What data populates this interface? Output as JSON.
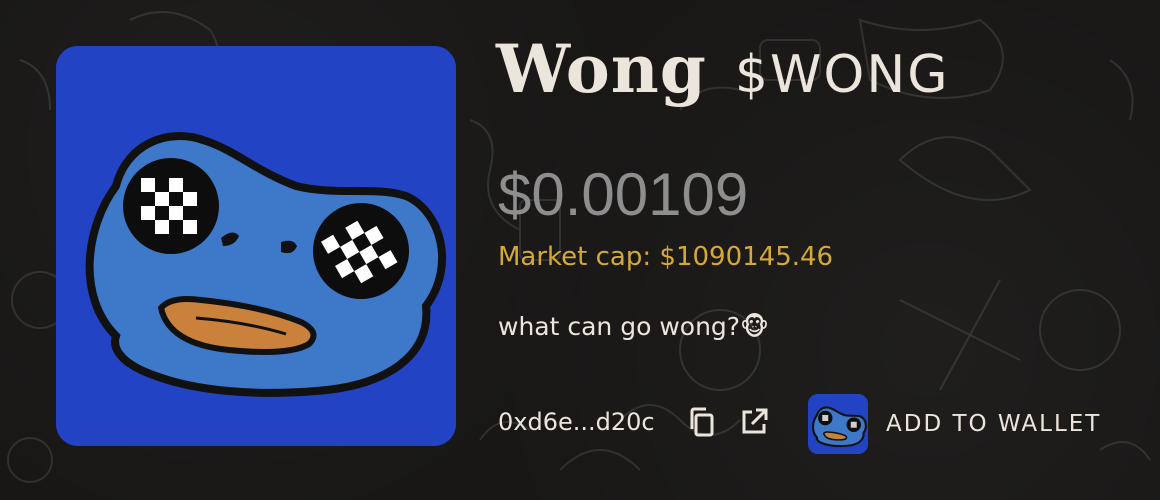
{
  "token": {
    "name": "Wong",
    "ticker": "$WONG",
    "price": "$0.00109",
    "market_cap": "Market cap: $1090145.46",
    "tagline": "what can go wong?🐵",
    "address": "0xd6e...d20c",
    "image_icon": "frog-face-icon"
  },
  "actions": {
    "copy_icon": "copy-icon",
    "external_icon": "external-link-icon",
    "add_to_wallet_label": "ADD TO WALLET"
  },
  "colors": {
    "background": "#181716",
    "token_blue": "#2243c3",
    "frog_blue": "#3d78c9",
    "beak_orange": "#c9813c",
    "market_cap_gold": "#d4a93a",
    "text_cream": "#ece5db",
    "price_gray": "#8e8e8e"
  }
}
